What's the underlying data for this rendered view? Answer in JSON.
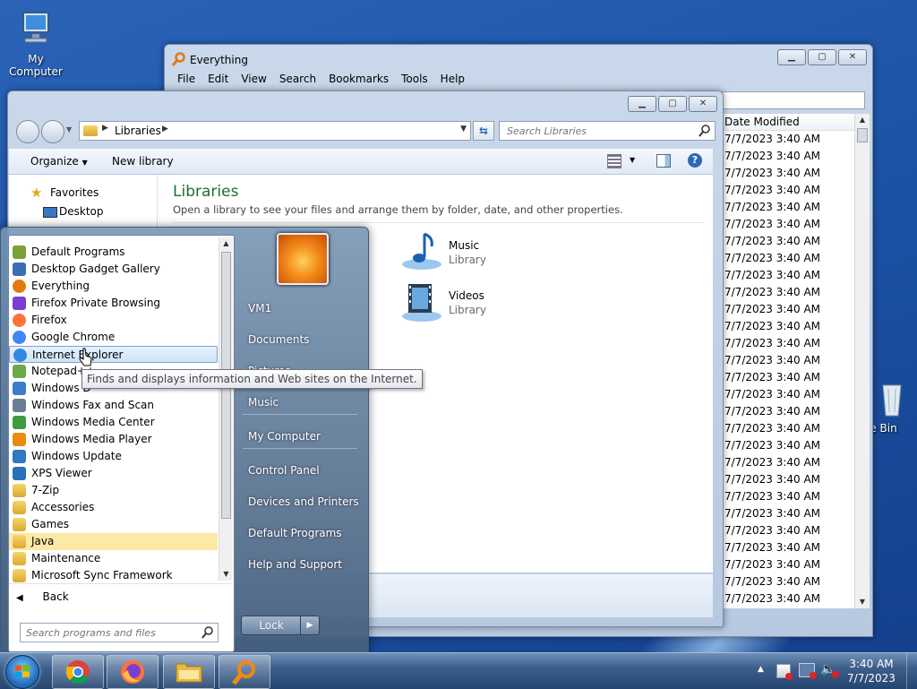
{
  "desktop": {
    "my_computer": "My Computer",
    "recycle_bin": "le Bin"
  },
  "everything": {
    "title": "Everything",
    "menu": [
      "File",
      "Edit",
      "View",
      "Search",
      "Bookmarks",
      "Tools",
      "Help"
    ],
    "column_header": "Date Modified",
    "rows": [
      "7/7/2023 3:40 AM",
      "7/7/2023 3:40 AM",
      "7/7/2023 3:40 AM",
      "7/7/2023 3:40 AM",
      "7/7/2023 3:40 AM",
      "7/7/2023 3:40 AM",
      "7/7/2023 3:40 AM",
      "7/7/2023 3:40 AM",
      "7/7/2023 3:40 AM",
      "7/7/2023 3:40 AM",
      "7/7/2023 3:40 AM",
      "7/7/2023 3:40 AM",
      "7/7/2023 3:40 AM",
      "7/7/2023 3:40 AM",
      "7/7/2023 3:40 AM",
      "7/7/2023 3:40 AM",
      "7/7/2023 3:40 AM",
      "7/7/2023 3:40 AM",
      "7/7/2023 3:40 AM",
      "7/7/2023 3:40 AM",
      "7/7/2023 3:40 AM",
      "7/7/2023 3:40 AM",
      "7/7/2023 3:40 AM",
      "7/7/2023 3:40 AM",
      "7/7/2023 3:40 AM",
      "7/7/2023 3:40 AM",
      "7/7/2023 3:40 AM",
      "7/7/2023 3:40 AM",
      "7/7/2023 3:40 AM"
    ]
  },
  "explorer": {
    "address": "Libraries",
    "search_placeholder": "Search Libraries",
    "organize": "Organize",
    "new_library": "New library",
    "nav": {
      "favorites": "Favorites",
      "desktop": "Desktop"
    },
    "heading": "Libraries",
    "subheading": "Open a library to see your files and arrange them by folder, date, and other properties.",
    "libraries": [
      {
        "name": "Music",
        "type": "Library"
      },
      {
        "name": "Videos",
        "type": "Library"
      }
    ]
  },
  "start_menu": {
    "programs": [
      "Default Programs",
      "Desktop Gadget Gallery",
      "Everything",
      "Firefox Private Browsing",
      "Firefox",
      "Google Chrome",
      "Internet Explorer",
      "Notepad++",
      "Windows D",
      "Windows Fax and Scan",
      "Windows Media Center",
      "Windows Media Player",
      "Windows Update",
      "XPS Viewer",
      "7-Zip",
      "Accessories",
      "Games",
      "Java",
      "Maintenance",
      "Microsoft Sync Framework"
    ],
    "back": "Back",
    "search_placeholder": "Search programs and files",
    "right": [
      "VM1",
      "Documents",
      "Pictures",
      "Music",
      "My Computer",
      "Control Panel",
      "Devices and Printers",
      "Default Programs",
      "Help and Support"
    ],
    "lock": "Lock",
    "tooltip": "Finds and displays information and Web sites on the Internet."
  },
  "taskbar": {
    "time": "3:40 AM",
    "date": "7/7/2023"
  },
  "colors": {
    "accent_green": "#1e6e2e",
    "selection": "#cfe3f8",
    "java_highlight": "#fde9a6"
  }
}
